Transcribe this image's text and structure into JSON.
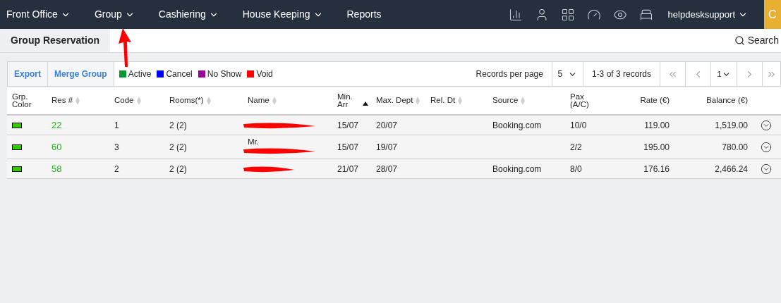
{
  "nav": {
    "menus": [
      {
        "label": "Front Office",
        "dropdown": true
      },
      {
        "label": "Group",
        "dropdown": true
      },
      {
        "label": "Cashiering",
        "dropdown": true
      },
      {
        "label": "House Keeping",
        "dropdown": true
      },
      {
        "label": "Reports",
        "dropdown": false
      }
    ],
    "icons": [
      {
        "kind": "chart"
      },
      {
        "kind": "user"
      },
      {
        "kind": "grid"
      },
      {
        "kind": "gauge"
      },
      {
        "kind": "eye"
      },
      {
        "kind": "bed"
      }
    ],
    "user": "helpdesksupport",
    "action_glyph": "C"
  },
  "annotation": {
    "kind": "arrow"
  },
  "tab": {
    "label": "Group Reservation",
    "selected": true
  },
  "search": {
    "label": "Search"
  },
  "toolbar": {
    "buttons": [
      "Export",
      "Merge Group"
    ],
    "legend": [
      {
        "label": "Active",
        "color": "#069a2e"
      },
      {
        "label": "Cancel",
        "color": "#0000ff"
      },
      {
        "label": "No Show",
        "color": "#990099"
      },
      {
        "label": "Void",
        "color": "#ff0000"
      }
    ],
    "per_page_label": "Records per page",
    "per_page": "5",
    "records": "1-3 of 3 records",
    "page": "1"
  },
  "table": {
    "columns": [
      {
        "label": "Grp. Color",
        "sortable": false
      },
      {
        "label": "Res #",
        "sortable": true,
        "sorted": false
      },
      {
        "label": "Code",
        "sortable": true,
        "sorted": false
      },
      {
        "label": "Rooms(*)",
        "sortable": true,
        "sorted": false
      },
      {
        "label": "Name",
        "sortable": true,
        "sorted": false
      },
      {
        "label": "Min. Arr",
        "sortable": true,
        "sorted": true
      },
      {
        "label": "Max. Dept",
        "sortable": true,
        "sorted": false
      },
      {
        "label": "Rel. Dt",
        "sortable": true,
        "sorted": false
      },
      {
        "label": "Source",
        "sortable": true,
        "sorted": false
      },
      {
        "label": "Pax (A/C)",
        "sortable": false
      },
      {
        "label": "Rate (€)",
        "sortable": false
      },
      {
        "label": "Balance (€)",
        "sortable": false
      }
    ],
    "rows": [
      {
        "color": "#33cc00",
        "res": "22",
        "code": "1",
        "rooms": "2 (2)",
        "redacted": true,
        "arr": "15/07",
        "dept": "20/07",
        "source": "Booking.com",
        "pax": "10/0",
        "rate": "119.00",
        "balance": "1,519.00"
      },
      {
        "color": "#33cc00",
        "res": "60",
        "code": "3",
        "rooms": "2 (2)",
        "name": "Mr.",
        "redacted": true,
        "arr": "15/07",
        "dept": "19/07",
        "pax": "2/2",
        "rate": "195.00",
        "balance": "780.00"
      },
      {
        "color": "#33cc00",
        "res": "58",
        "code": "2",
        "rooms": "2 (2)",
        "redacted": true,
        "arr": "21/07",
        "dept": "28/07",
        "source": "Booking.com",
        "pax": "8/0",
        "rate": "176.16",
        "balance": "2,466.24"
      }
    ]
  }
}
